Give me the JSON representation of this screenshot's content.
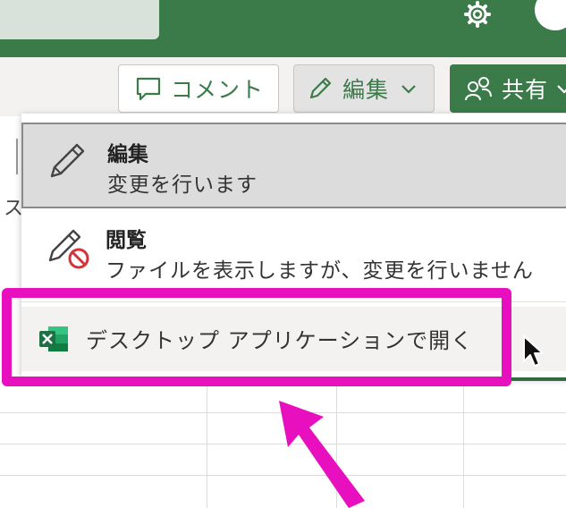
{
  "toolbar": {
    "comment_label": "コメント",
    "edit_label": "編集",
    "share_label": "共有"
  },
  "background": {
    "ribbon_fragment": "ス"
  },
  "menu": {
    "items": [
      {
        "title": "編集",
        "description": "変更を行います",
        "icon": "pencil-icon"
      },
      {
        "title": "閲覧",
        "description": "ファイルを表示しますが、変更を行いません",
        "icon": "pencil-prohibited-icon"
      }
    ],
    "open_desktop": {
      "label": "デスクトップ アプリケーションで開く",
      "icon": "excel-icon"
    }
  },
  "colors": {
    "accent_green": "#3b7b4a",
    "highlight_magenta": "#e80fbe",
    "excel_green": "#1e7145"
  }
}
